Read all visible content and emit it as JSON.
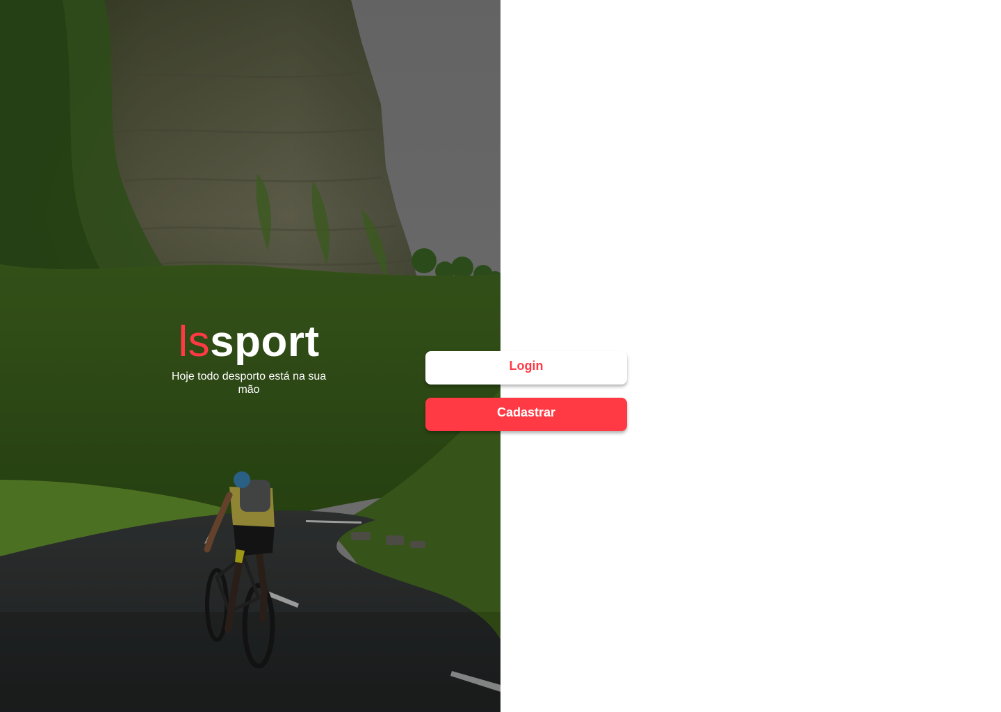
{
  "brand": {
    "logo_part1": "ls",
    "logo_part2": "sport",
    "tagline": "Hoje todo desporto está na sua mão"
  },
  "actions": {
    "login_label": "Login",
    "register_label": "Cadastrar"
  },
  "colors": {
    "accent": "#ff3a44",
    "white": "#ffffff"
  },
  "hero": {
    "image_subject": "cyclist-on-mountain-road"
  }
}
